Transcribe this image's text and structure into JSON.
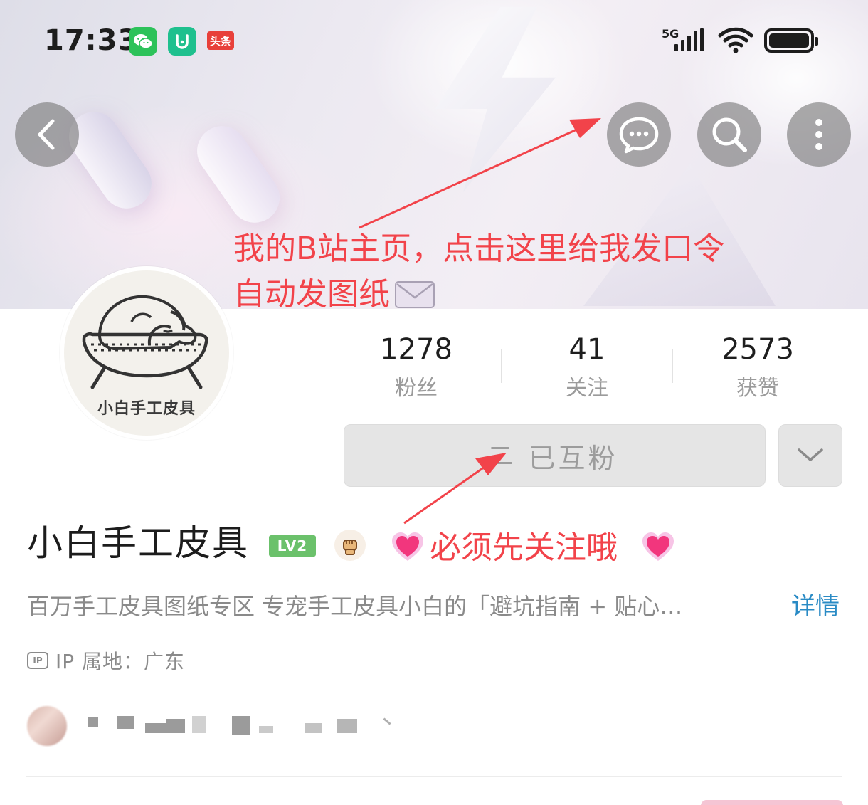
{
  "status_bar": {
    "time": "17:33",
    "network": "5G",
    "app_icons": [
      "wechat-icon",
      "mi-home-icon",
      "toutiao-icon"
    ],
    "toutiao_label": "头条"
  },
  "nav": {
    "back_icon": "chevron-left-icon",
    "message_icon": "chat-bubble-icon",
    "search_icon": "search-icon",
    "more_icon": "more-vertical-icon"
  },
  "annotations": {
    "line1": "我的B站主页，点击这里给我发口令",
    "line2": "自动发图纸",
    "follow_note": "必须先关注哦",
    "color": "#f2434a"
  },
  "avatar": {
    "label": "小白手工皮具"
  },
  "stats": [
    {
      "value": "1278",
      "label": "粉丝"
    },
    {
      "value": "41",
      "label": "关注"
    },
    {
      "value": "2573",
      "label": "获赞"
    }
  ],
  "follow": {
    "label": "已互粉"
  },
  "profile": {
    "name": "小白手工皮具",
    "level": "LV2",
    "bio": "百万手工皮具图纸专区 专宠手工皮具小白的「避坑指南 + 贴心…",
    "detail_link": "详情",
    "ip": "IP 属地：广东",
    "link_color": "#2a8bc5"
  }
}
